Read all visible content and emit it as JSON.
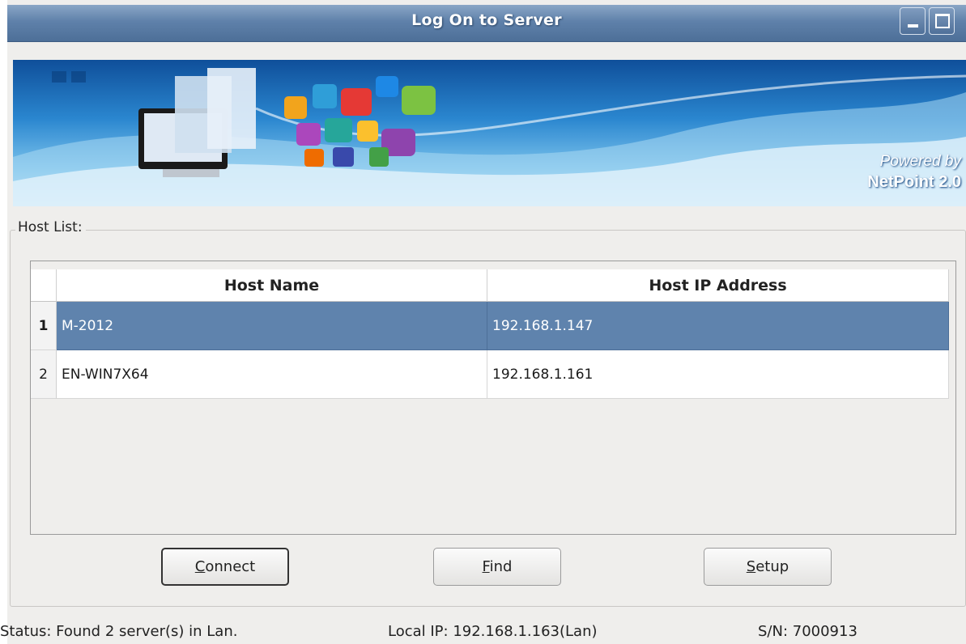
{
  "window": {
    "title": "Log On to Server",
    "minimize_icon": "minimize-icon",
    "maximize_icon": "maximize-icon"
  },
  "banner": {
    "powered_line1": "Powered by",
    "powered_line2": "NetPoint 2.0"
  },
  "host_list": {
    "label": "Host List:",
    "columns": [
      "Host Name",
      "Host IP Address"
    ],
    "rows": [
      {
        "num": "1",
        "name": "M-2012",
        "ip": "192.168.1.147",
        "selected": true
      },
      {
        "num": "2",
        "name": "EN-WIN7X64",
        "ip": "192.168.1.161",
        "selected": false
      }
    ]
  },
  "buttons": {
    "connect_pre": "",
    "connect_key": "C",
    "connect_rest": "onnect",
    "find_key": "F",
    "find_rest": "ind",
    "setup_key": "S",
    "setup_rest": "etup"
  },
  "status": {
    "status_text": "Status:  Found 2 server(s) in Lan.",
    "local_ip_text": "Local IP:  192.168.1.163(Lan)",
    "sn_text": "S/N:  7000913"
  },
  "colors": {
    "titlebar": "#5f81aa",
    "selection": "#5f83ad",
    "window_bg": "#efeeec"
  }
}
